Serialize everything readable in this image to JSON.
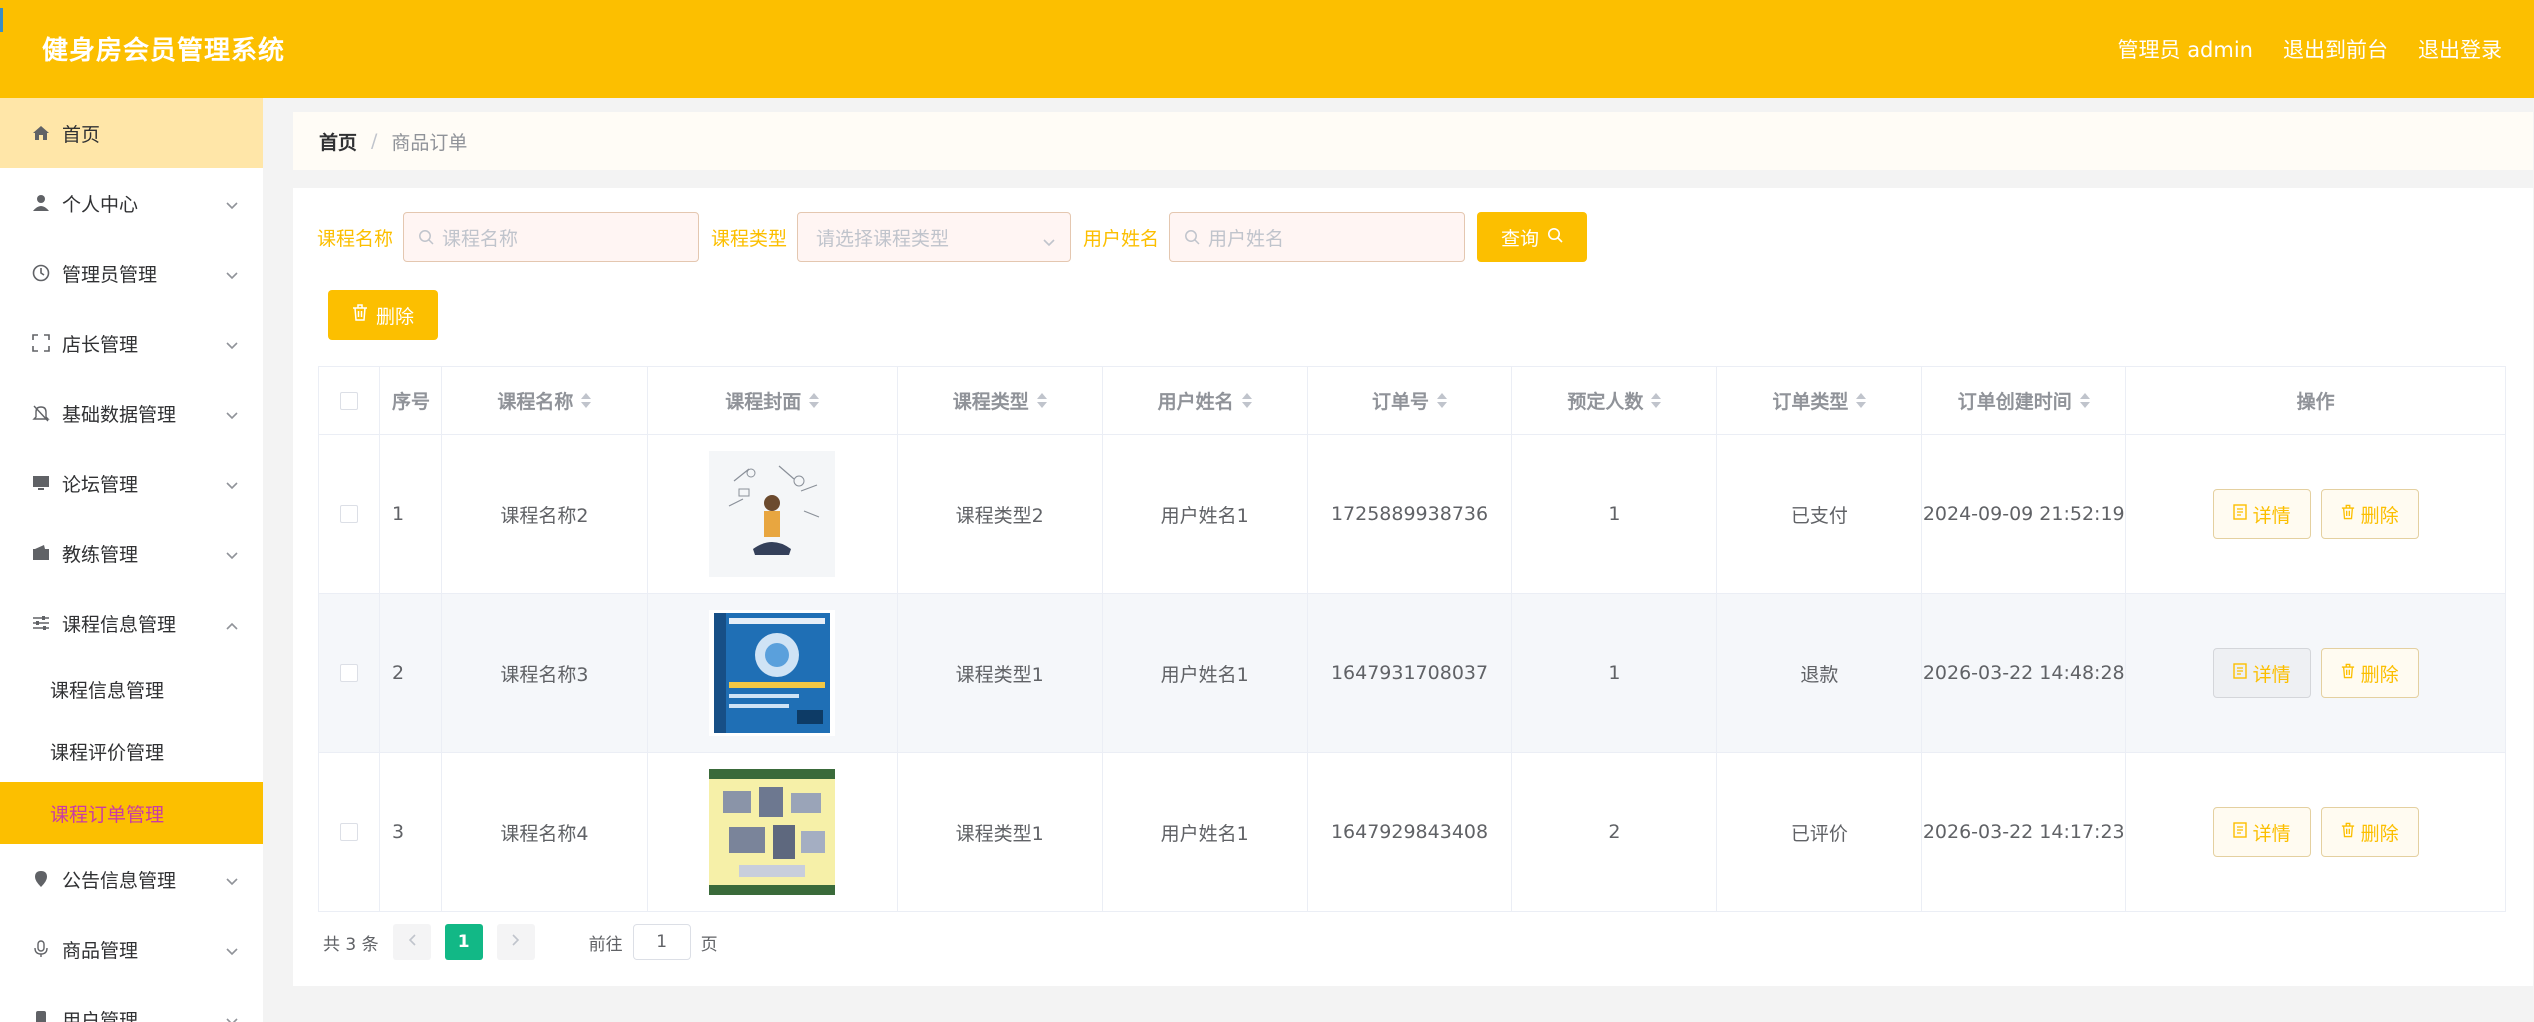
{
  "header": {
    "title": "健身房会员管理系统",
    "admin_label": "管理员 admin",
    "to_front": "退出到前台",
    "logout": "退出登录"
  },
  "sidebar": {
    "items": [
      {
        "label": "首页",
        "icon": "home-icon"
      },
      {
        "label": "个人中心",
        "icon": "user-icon"
      },
      {
        "label": "管理员管理",
        "icon": "clock-icon"
      },
      {
        "label": "店长管理",
        "icon": "fullscreen-icon"
      },
      {
        "label": "基础数据管理",
        "icon": "bell-off-icon"
      },
      {
        "label": "论坛管理",
        "icon": "monitor-icon"
      },
      {
        "label": "教练管理",
        "icon": "wallet-icon"
      },
      {
        "label": "课程信息管理",
        "icon": "sliders-icon"
      },
      {
        "label": "公告信息管理",
        "icon": "map-pin-icon"
      },
      {
        "label": "商品管理",
        "icon": "microphone-icon"
      },
      {
        "label": "用户管理",
        "icon": "phone-icon"
      }
    ],
    "submenu": [
      "课程信息管理",
      "课程评价管理",
      "课程订单管理"
    ]
  },
  "breadcrumb": {
    "home": "首页",
    "separator": "/",
    "current": "商品订单"
  },
  "search": {
    "course_name_label": "课程名称",
    "course_name_placeholder": "课程名称",
    "course_type_label": "课程类型",
    "course_type_placeholder": "请选择课程类型",
    "user_name_label": "用户姓名",
    "user_name_placeholder": "用户姓名",
    "query_button": "查询"
  },
  "toolbar": {
    "delete_button": "删除"
  },
  "table": {
    "headers": [
      "序号",
      "课程名称",
      "课程封面",
      "课程类型",
      "用户姓名",
      "订单号",
      "预定人数",
      "订单类型",
      "订单创建时间",
      "操作"
    ],
    "rows": [
      {
        "idx": "1",
        "name": "课程名称2",
        "type": "课程类型2",
        "user": "用户姓名1",
        "order": "1725889938736",
        "count": "1",
        "otype": "已支付",
        "time": "2024-09-09 21:52:19"
      },
      {
        "idx": "2",
        "name": "课程名称3",
        "type": "课程类型1",
        "user": "用户姓名1",
        "order": "1647931708037",
        "count": "1",
        "otype": "退款",
        "time": "2026-03-22 14:48:28"
      },
      {
        "idx": "3",
        "name": "课程名称4",
        "type": "课程类型1",
        "user": "用户姓名1",
        "order": "1647929843408",
        "count": "2",
        "otype": "已评价",
        "time": "2026-03-22 14:17:23"
      }
    ],
    "detail_label": "详情",
    "delete_label": "删除"
  },
  "pagination": {
    "total": "共 3 条",
    "current_page": "1",
    "goto_prefix": "前往",
    "goto_value": "1",
    "goto_suffix": "页"
  },
  "colors": {
    "primary": "#fcbf00",
    "active_page": "#12b886",
    "active_submenu_text": "#c93ba6"
  }
}
